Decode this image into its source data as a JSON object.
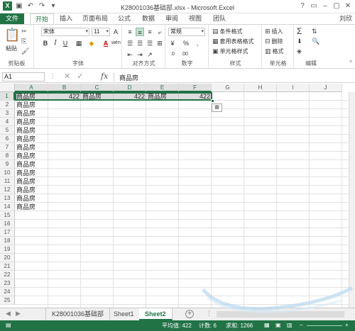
{
  "window": {
    "title": "K28001036基础部.xlsx - Microsoft Excel",
    "controls": [
      "?",
      "▭",
      "–",
      "▢",
      "✕"
    ]
  },
  "qat": {
    "app": "X"
  },
  "tabs": [
    {
      "label": "文件",
      "id": "file"
    },
    {
      "label": "开始",
      "id": "home"
    },
    {
      "label": "插入",
      "id": "insert"
    },
    {
      "label": "页面布局",
      "id": "layout"
    },
    {
      "label": "公式",
      "id": "formulas"
    },
    {
      "label": "数据",
      "id": "data"
    },
    {
      "label": "审阅",
      "id": "review"
    },
    {
      "label": "视图",
      "id": "view"
    },
    {
      "label": "团队",
      "id": "team"
    }
  ],
  "user": "刘欣",
  "ribbon": {
    "clipboard": {
      "label": "剪贴板",
      "paste": "粘贴"
    },
    "font": {
      "label": "字体",
      "name": "宋体",
      "size": "11",
      "bold": "B",
      "italic": "I",
      "underline": "U",
      "grow": "A",
      "shrink": "A",
      "color": "A",
      "wen": "wén"
    },
    "alignment": {
      "label": "对齐方式"
    },
    "number": {
      "label": "数字",
      "format": "常规",
      "percent": "%",
      "comma": ","
    },
    "styles": {
      "label": "样式",
      "conditional": "条件格式",
      "table": "套用表格格式",
      "cell": "单元格样式"
    },
    "cells": {
      "label": "单元格",
      "insert": "插入",
      "delete": "删除",
      "format": "格式"
    },
    "editing": {
      "label": "编辑",
      "sum": "Σ"
    }
  },
  "formula_bar": {
    "name_box": "A1",
    "fx": "fx",
    "content": "商品房"
  },
  "grid": {
    "columns": [
      "A",
      "B",
      "C",
      "D",
      "E",
      "F",
      "G",
      "H",
      "I",
      "J"
    ],
    "rows": [
      "1",
      "2",
      "3",
      "4",
      "5",
      "6",
      "7",
      "8",
      "9",
      "10",
      "11",
      "12",
      "13",
      "14",
      "15",
      "16",
      "17",
      "18",
      "19",
      "20",
      "21",
      "22",
      "23",
      "24",
      "25"
    ],
    "row1": {
      "A": "商品房",
      "B": "422",
      "C": "商品房",
      "D": "422",
      "E": "商品房",
      "F": "422"
    },
    "col_a": [
      "商品房",
      "商品房",
      "商品房",
      "商品房",
      "商品房",
      "商品房",
      "商品房",
      "商品房",
      "商品房",
      "商品房",
      "商品房",
      "商品房",
      "商品房"
    ]
  },
  "sheets": {
    "tabs": [
      "K28001036基础部",
      "Sheet1",
      "Sheet2"
    ],
    "active": "Sheet2",
    "add": "+"
  },
  "status": {
    "average": "平均值: 422",
    "count": "计数: 6",
    "sum": "求和: 1266"
  }
}
